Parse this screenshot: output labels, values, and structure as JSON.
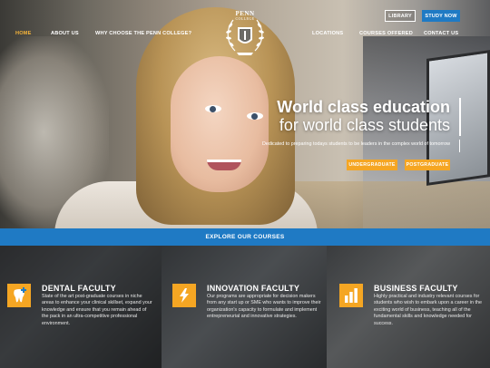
{
  "header": {
    "logo_title": "PENN",
    "logo_sub": "COLLEGE",
    "library_button": "LIBRARY",
    "study_button": "STUDY NOW",
    "nav": [
      {
        "label": "HOME",
        "active": true
      },
      {
        "label": "ABOUT US"
      },
      {
        "label": "WHY CHOOSE THE PENN COLLEGE?"
      },
      {
        "label": "LOCATIONS"
      },
      {
        "label": "COURSES OFFERED"
      },
      {
        "label": "CONTACT US"
      }
    ]
  },
  "hero": {
    "headline": "World class education",
    "subline": "for world class students",
    "tagline": "Dedicated to preparing todays students to be leaders in the complex world of tomorrow",
    "undergraduate_button": "UNDERGRADUATE",
    "postgraduate_button": "POSTGRADUATE"
  },
  "explore": {
    "label": "EXPLORE OUR COURSES"
  },
  "courses": [
    {
      "title": "DENTAL FACULTY",
      "icon": "tooth-plus-icon",
      "description": "State of the art post-graduate courses in niche areas to enhance your clinical skillset, expand your knowledge and ensure that you remain ahead of the pack in an ultra-competitive professional environment."
    },
    {
      "title": "INNOVATION FACULTY",
      "icon": "lightning-bolt-icon",
      "description": "Our programs are appropriate for decision makers from any start up or SME who wants to improve their organization's capacity to formulate and implement entrepreneurial and innovative strategies."
    },
    {
      "title": "BUSINESS FACULTY",
      "icon": "bar-chart-icon",
      "description": "Highly practical and industry relevant courses for students who wish to embark upon a career in the exciting world of business, teaching all of the fundamental skills and knowledge needed for success."
    }
  ],
  "colors": {
    "accent_blue": "#1f7ac4",
    "accent_orange": "#f5a623",
    "nav_active": "#f5b43a"
  }
}
